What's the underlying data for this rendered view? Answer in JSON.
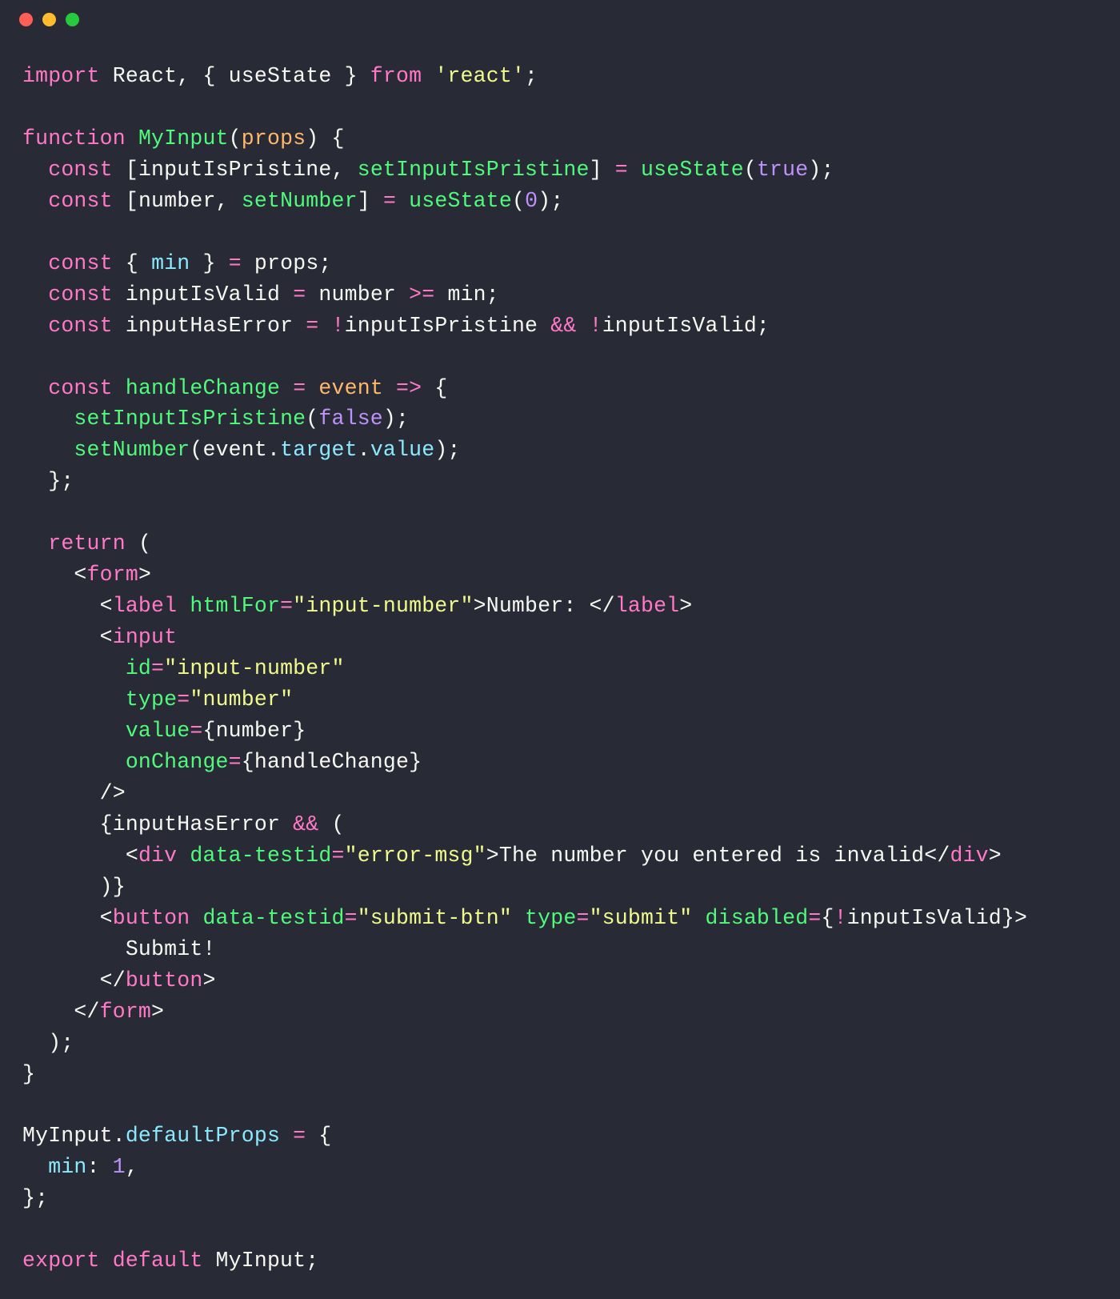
{
  "titlebar": {
    "buttons": [
      "close",
      "minimize",
      "zoom"
    ]
  },
  "code": {
    "lines": [
      [
        {
          "t": "import ",
          "c": "c-kw"
        },
        {
          "t": "React",
          "c": "c-var"
        },
        {
          "t": ", { ",
          "c": "c-pun"
        },
        {
          "t": "useState",
          "c": "c-var"
        },
        {
          "t": " } ",
          "c": "c-pun"
        },
        {
          "t": "from ",
          "c": "c-kw"
        },
        {
          "t": "'react'",
          "c": "c-str"
        },
        {
          "t": ";",
          "c": "c-pun"
        }
      ],
      [],
      [
        {
          "t": "function ",
          "c": "c-kw"
        },
        {
          "t": "MyInput",
          "c": "c-fn"
        },
        {
          "t": "(",
          "c": "c-pun"
        },
        {
          "t": "props",
          "c": "c-prm"
        },
        {
          "t": ") {",
          "c": "c-pun"
        }
      ],
      [
        {
          "t": "  ",
          "c": "c-pun"
        },
        {
          "t": "const ",
          "c": "c-kw"
        },
        {
          "t": "[",
          "c": "c-pun"
        },
        {
          "t": "inputIsPristine",
          "c": "c-var"
        },
        {
          "t": ", ",
          "c": "c-pun"
        },
        {
          "t": "setInputIsPristine",
          "c": "c-fn"
        },
        {
          "t": "] ",
          "c": "c-pun"
        },
        {
          "t": "= ",
          "c": "c-op"
        },
        {
          "t": "useState",
          "c": "c-fn"
        },
        {
          "t": "(",
          "c": "c-pun"
        },
        {
          "t": "true",
          "c": "c-num"
        },
        {
          "t": ");",
          "c": "c-pun"
        }
      ],
      [
        {
          "t": "  ",
          "c": "c-pun"
        },
        {
          "t": "const ",
          "c": "c-kw"
        },
        {
          "t": "[",
          "c": "c-pun"
        },
        {
          "t": "number",
          "c": "c-var"
        },
        {
          "t": ", ",
          "c": "c-pun"
        },
        {
          "t": "setNumber",
          "c": "c-fn"
        },
        {
          "t": "] ",
          "c": "c-pun"
        },
        {
          "t": "= ",
          "c": "c-op"
        },
        {
          "t": "useState",
          "c": "c-fn"
        },
        {
          "t": "(",
          "c": "c-pun"
        },
        {
          "t": "0",
          "c": "c-num"
        },
        {
          "t": ");",
          "c": "c-pun"
        }
      ],
      [],
      [
        {
          "t": "  ",
          "c": "c-pun"
        },
        {
          "t": "const ",
          "c": "c-kw"
        },
        {
          "t": "{ ",
          "c": "c-pun"
        },
        {
          "t": "min",
          "c": "c-prop"
        },
        {
          "t": " } ",
          "c": "c-pun"
        },
        {
          "t": "= ",
          "c": "c-op"
        },
        {
          "t": "props;",
          "c": "c-var"
        }
      ],
      [
        {
          "t": "  ",
          "c": "c-pun"
        },
        {
          "t": "const ",
          "c": "c-kw"
        },
        {
          "t": "inputIsValid ",
          "c": "c-var"
        },
        {
          "t": "= ",
          "c": "c-op"
        },
        {
          "t": "number ",
          "c": "c-var"
        },
        {
          "t": ">= ",
          "c": "c-op"
        },
        {
          "t": "min;",
          "c": "c-var"
        }
      ],
      [
        {
          "t": "  ",
          "c": "c-pun"
        },
        {
          "t": "const ",
          "c": "c-kw"
        },
        {
          "t": "inputHasError ",
          "c": "c-var"
        },
        {
          "t": "= ",
          "c": "c-op"
        },
        {
          "t": "!",
          "c": "c-op"
        },
        {
          "t": "inputIsPristine ",
          "c": "c-var"
        },
        {
          "t": "&& ",
          "c": "c-op"
        },
        {
          "t": "!",
          "c": "c-op"
        },
        {
          "t": "inputIsValid;",
          "c": "c-var"
        }
      ],
      [],
      [
        {
          "t": "  ",
          "c": "c-pun"
        },
        {
          "t": "const ",
          "c": "c-kw"
        },
        {
          "t": "handleChange",
          "c": "c-fn"
        },
        {
          "t": " ",
          "c": "c-pun"
        },
        {
          "t": "= ",
          "c": "c-op"
        },
        {
          "t": "event",
          "c": "c-prm"
        },
        {
          "t": " ",
          "c": "c-pun"
        },
        {
          "t": "=> ",
          "c": "c-op"
        },
        {
          "t": "{",
          "c": "c-pun"
        }
      ],
      [
        {
          "t": "    ",
          "c": "c-pun"
        },
        {
          "t": "setInputIsPristine",
          "c": "c-fn"
        },
        {
          "t": "(",
          "c": "c-pun"
        },
        {
          "t": "false",
          "c": "c-num"
        },
        {
          "t": ");",
          "c": "c-pun"
        }
      ],
      [
        {
          "t": "    ",
          "c": "c-pun"
        },
        {
          "t": "setNumber",
          "c": "c-fn"
        },
        {
          "t": "(",
          "c": "c-pun"
        },
        {
          "t": "event",
          "c": "c-var"
        },
        {
          "t": ".",
          "c": "c-pun"
        },
        {
          "t": "target",
          "c": "c-prop"
        },
        {
          "t": ".",
          "c": "c-pun"
        },
        {
          "t": "value",
          "c": "c-prop"
        },
        {
          "t": ");",
          "c": "c-pun"
        }
      ],
      [
        {
          "t": "  };",
          "c": "c-pun"
        }
      ],
      [],
      [
        {
          "t": "  ",
          "c": "c-pun"
        },
        {
          "t": "return ",
          "c": "c-kw"
        },
        {
          "t": "(",
          "c": "c-pun"
        }
      ],
      [
        {
          "t": "    <",
          "c": "c-pun"
        },
        {
          "t": "form",
          "c": "c-tag"
        },
        {
          "t": ">",
          "c": "c-pun"
        }
      ],
      [
        {
          "t": "      <",
          "c": "c-pun"
        },
        {
          "t": "label",
          "c": "c-tag"
        },
        {
          "t": " ",
          "c": "c-pun"
        },
        {
          "t": "htmlFor",
          "c": "c-attr"
        },
        {
          "t": "=",
          "c": "c-op"
        },
        {
          "t": "\"input-number\"",
          "c": "c-str"
        },
        {
          "t": ">",
          "c": "c-pun"
        },
        {
          "t": "Number: ",
          "c": "c-var"
        },
        {
          "t": "</",
          "c": "c-pun"
        },
        {
          "t": "label",
          "c": "c-tag"
        },
        {
          "t": ">",
          "c": "c-pun"
        }
      ],
      [
        {
          "t": "      <",
          "c": "c-pun"
        },
        {
          "t": "input",
          "c": "c-tag"
        }
      ],
      [
        {
          "t": "        ",
          "c": "c-pun"
        },
        {
          "t": "id",
          "c": "c-attr"
        },
        {
          "t": "=",
          "c": "c-op"
        },
        {
          "t": "\"input-number\"",
          "c": "c-str"
        }
      ],
      [
        {
          "t": "        ",
          "c": "c-pun"
        },
        {
          "t": "type",
          "c": "c-attr"
        },
        {
          "t": "=",
          "c": "c-op"
        },
        {
          "t": "\"number\"",
          "c": "c-str"
        }
      ],
      [
        {
          "t": "        ",
          "c": "c-pun"
        },
        {
          "t": "value",
          "c": "c-attr"
        },
        {
          "t": "=",
          "c": "c-op"
        },
        {
          "t": "{",
          "c": "c-pun"
        },
        {
          "t": "number",
          "c": "c-var"
        },
        {
          "t": "}",
          "c": "c-pun"
        }
      ],
      [
        {
          "t": "        ",
          "c": "c-pun"
        },
        {
          "t": "onChange",
          "c": "c-attr"
        },
        {
          "t": "=",
          "c": "c-op"
        },
        {
          "t": "{",
          "c": "c-pun"
        },
        {
          "t": "handleChange",
          "c": "c-var"
        },
        {
          "t": "}",
          "c": "c-pun"
        }
      ],
      [
        {
          "t": "      />",
          "c": "c-pun"
        }
      ],
      [
        {
          "t": "      {",
          "c": "c-pun"
        },
        {
          "t": "inputHasError",
          "c": "c-var"
        },
        {
          "t": " ",
          "c": "c-pun"
        },
        {
          "t": "&&",
          "c": "c-op"
        },
        {
          "t": " (",
          "c": "c-pun"
        }
      ],
      [
        {
          "t": "        <",
          "c": "c-pun"
        },
        {
          "t": "div",
          "c": "c-tag"
        },
        {
          "t": " ",
          "c": "c-pun"
        },
        {
          "t": "data-testid",
          "c": "c-attr"
        },
        {
          "t": "=",
          "c": "c-op"
        },
        {
          "t": "\"error-msg\"",
          "c": "c-str"
        },
        {
          "t": ">",
          "c": "c-pun"
        },
        {
          "t": "The number you entered is invalid",
          "c": "c-var"
        },
        {
          "t": "</",
          "c": "c-pun"
        },
        {
          "t": "div",
          "c": "c-tag"
        },
        {
          "t": ">",
          "c": "c-pun"
        }
      ],
      [
        {
          "t": "      )}",
          "c": "c-pun"
        }
      ],
      [
        {
          "t": "      <",
          "c": "c-pun"
        },
        {
          "t": "button",
          "c": "c-tag"
        },
        {
          "t": " ",
          "c": "c-pun"
        },
        {
          "t": "data-testid",
          "c": "c-attr"
        },
        {
          "t": "=",
          "c": "c-op"
        },
        {
          "t": "\"submit-btn\"",
          "c": "c-str"
        },
        {
          "t": " ",
          "c": "c-pun"
        },
        {
          "t": "type",
          "c": "c-attr"
        },
        {
          "t": "=",
          "c": "c-op"
        },
        {
          "t": "\"submit\"",
          "c": "c-str"
        },
        {
          "t": " ",
          "c": "c-pun"
        },
        {
          "t": "disabled",
          "c": "c-attr"
        },
        {
          "t": "=",
          "c": "c-op"
        },
        {
          "t": "{",
          "c": "c-pun"
        },
        {
          "t": "!",
          "c": "c-op"
        },
        {
          "t": "inputIsValid",
          "c": "c-var"
        },
        {
          "t": "}>",
          "c": "c-pun"
        }
      ],
      [
        {
          "t": "        Submit!",
          "c": "c-var"
        }
      ],
      [
        {
          "t": "      </",
          "c": "c-pun"
        },
        {
          "t": "button",
          "c": "c-tag"
        },
        {
          "t": ">",
          "c": "c-pun"
        }
      ],
      [
        {
          "t": "    </",
          "c": "c-pun"
        },
        {
          "t": "form",
          "c": "c-tag"
        },
        {
          "t": ">",
          "c": "c-pun"
        }
      ],
      [
        {
          "t": "  );",
          "c": "c-pun"
        }
      ],
      [
        {
          "t": "}",
          "c": "c-pun"
        }
      ],
      [],
      [
        {
          "t": "MyInput",
          "c": "c-var"
        },
        {
          "t": ".",
          "c": "c-pun"
        },
        {
          "t": "defaultProps",
          "c": "c-prop"
        },
        {
          "t": " ",
          "c": "c-pun"
        },
        {
          "t": "= ",
          "c": "c-op"
        },
        {
          "t": "{",
          "c": "c-pun"
        }
      ],
      [
        {
          "t": "  ",
          "c": "c-pun"
        },
        {
          "t": "min",
          "c": "c-prop"
        },
        {
          "t": ": ",
          "c": "c-pun"
        },
        {
          "t": "1",
          "c": "c-num"
        },
        {
          "t": ",",
          "c": "c-pun"
        }
      ],
      [
        {
          "t": "};",
          "c": "c-pun"
        }
      ],
      [],
      [
        {
          "t": "export ",
          "c": "c-kw"
        },
        {
          "t": "default ",
          "c": "c-kw"
        },
        {
          "t": "MyInput;",
          "c": "c-var"
        }
      ]
    ]
  }
}
